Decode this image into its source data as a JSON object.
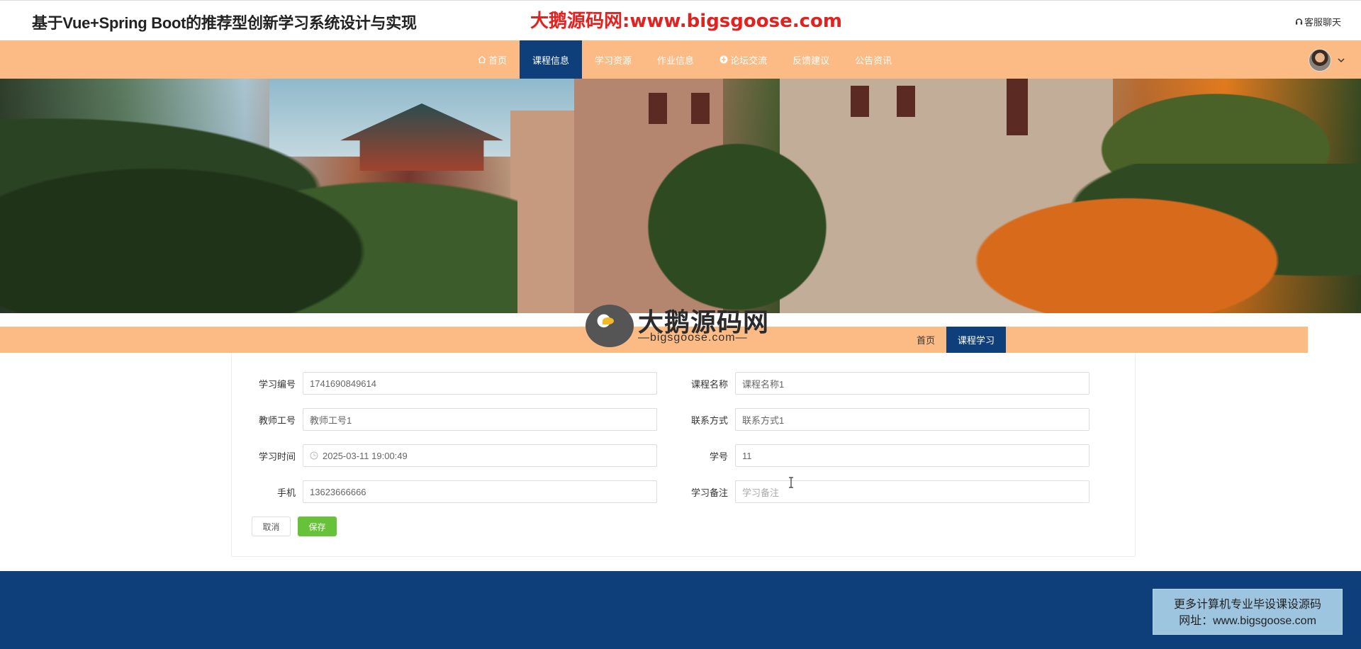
{
  "header": {
    "site_title": "基于Vue+Spring Boot的推荐型创新学习系统设计与实现",
    "watermark_url": "大鹅源码网:www.bigsgoose.com",
    "service_label": "客服聊天"
  },
  "nav": {
    "items": [
      {
        "label": "首页",
        "icon": "home-icon"
      },
      {
        "label": "课程信息"
      },
      {
        "label": "学习资源"
      },
      {
        "label": "作业信息"
      },
      {
        "label": "论坛交流",
        "icon": "plus-circle-icon"
      },
      {
        "label": "反馈建议"
      },
      {
        "label": "公告资讯"
      }
    ],
    "active_index": 1
  },
  "breadcrumb": {
    "items": [
      "首页",
      "课程学习"
    ]
  },
  "logo": {
    "text": "大鹅源码网",
    "sub": "—bigsgoose.com—"
  },
  "form": {
    "fields": [
      {
        "label": "学习编号",
        "value": "1741690849614"
      },
      {
        "label": "课程名称",
        "value": "课程名称1"
      },
      {
        "label": "教师工号",
        "value": "教师工号1"
      },
      {
        "label": "联系方式",
        "value": "联系方式1"
      },
      {
        "label": "学习时间",
        "value": "2025-03-11 19:00:49"
      },
      {
        "label": "学号",
        "value": "11"
      },
      {
        "label": "手机",
        "value": "13623666666"
      },
      {
        "label": "学习备注",
        "placeholder": "学习备注"
      }
    ],
    "cancel_label": "取消",
    "save_label": "保存"
  },
  "promo": {
    "line1": "更多计算机专业毕设课设源码",
    "line2": "网址：www.bigsgoose.com"
  },
  "colors": {
    "nav_bg": "#fcbb85",
    "active_bg": "#0e3f7b",
    "save_green": "#67c23a",
    "watermark_red": "#e3211f"
  }
}
